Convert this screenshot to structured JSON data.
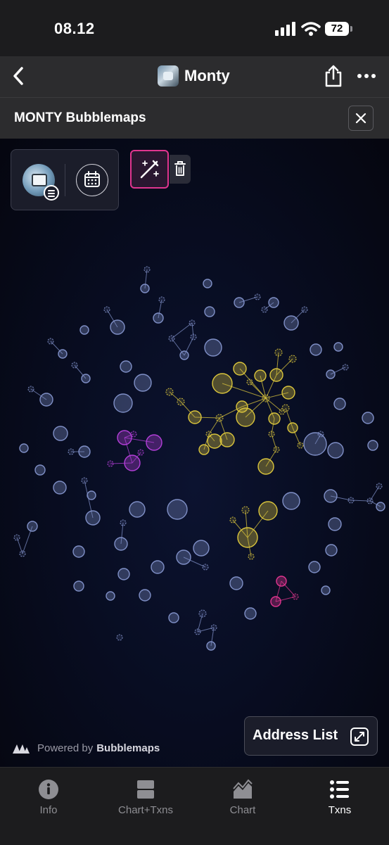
{
  "status_bar": {
    "time": "08.12",
    "battery": "72"
  },
  "nav": {
    "title": "Monty"
  },
  "panel": {
    "title": "MONTY Bubblemaps"
  },
  "map": {
    "powered_by_prefix": "Powered by",
    "powered_by_brand": "Bubblemaps",
    "address_list_label": "Address List",
    "cluster_colors": {
      "default": "#7f8fc6",
      "yellow": "#d9c43c",
      "purple": "#b33fd8",
      "pink": "#e0358f"
    }
  },
  "tabs": [
    {
      "label": "Info",
      "icon": "info-icon"
    },
    {
      "label": "Chart+Txns",
      "icon": "chart-txns-icon"
    },
    {
      "label": "Chart",
      "icon": "chart-icon"
    },
    {
      "label": "Txns",
      "icon": "list-icon"
    }
  ]
}
